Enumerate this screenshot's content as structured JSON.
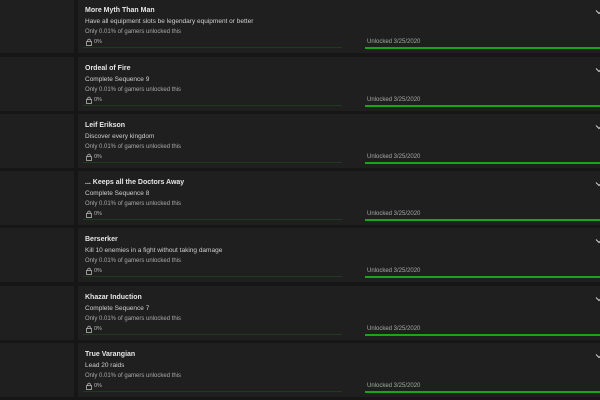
{
  "rarity_text": "Only 0.01% of gamers unlocked this",
  "achievements": [
    {
      "title": "More Myth Than Man",
      "description": "Have all equipment slots be legendary equipment or better",
      "rarity": "Only 0.01% of gamers unlocked this",
      "percent": "0%",
      "unlocked": "Unlocked 3/25/2020",
      "progress": 1.0,
      "rarity_fraction": 0.0001
    },
    {
      "title": "Ordeal of Fire",
      "description": "Complete Sequence 9",
      "rarity": "Only 0.01% of gamers unlocked this",
      "percent": "0%",
      "unlocked": "Unlocked 3/25/2020",
      "progress": 1.0,
      "rarity_fraction": 0.0001
    },
    {
      "title": "Leif Erikson",
      "description": "Discover every kingdom",
      "rarity": "Only 0.01% of gamers unlocked this",
      "percent": "0%",
      "unlocked": "Unlocked 3/25/2020",
      "progress": 1.0,
      "rarity_fraction": 0.0001
    },
    {
      "title": "... Keeps all the Doctors Away",
      "description": "Complete Sequence 8",
      "rarity": "Only 0.01% of gamers unlocked this",
      "percent": "0%",
      "unlocked": "Unlocked 3/25/2020",
      "progress": 1.0,
      "rarity_fraction": 0.0001
    },
    {
      "title": "Berserker",
      "description": "Kill 10 enemies in a fight without taking damage",
      "rarity": "Only 0.01% of gamers unlocked this",
      "percent": "0%",
      "unlocked": "Unlocked 3/25/2020",
      "progress": 1.0,
      "rarity_fraction": 0.0001
    },
    {
      "title": "Khazar Induction",
      "description": "Complete Sequence 7",
      "rarity": "Only 0.01% of gamers unlocked this",
      "percent": "0%",
      "unlocked": "Unlocked 3/25/2020",
      "progress": 1.0,
      "rarity_fraction": 0.0001
    },
    {
      "title": "True Varangian",
      "description": "Lead 20 raids",
      "rarity": "Only 0.01% of gamers unlocked this",
      "percent": "0%",
      "unlocked": "Unlocked 3/25/2020",
      "progress": 1.0,
      "rarity_fraction": 0.0001
    }
  ],
  "colors": {
    "background": "#161616",
    "card": "#1f1f1f",
    "progress_fill": "#19a519",
    "progress_track": "#1d3b1d",
    "rarity_track": "#1f3a1f"
  },
  "icons": {
    "rarity": "lock-icon",
    "expand": "chevron-down-icon"
  }
}
